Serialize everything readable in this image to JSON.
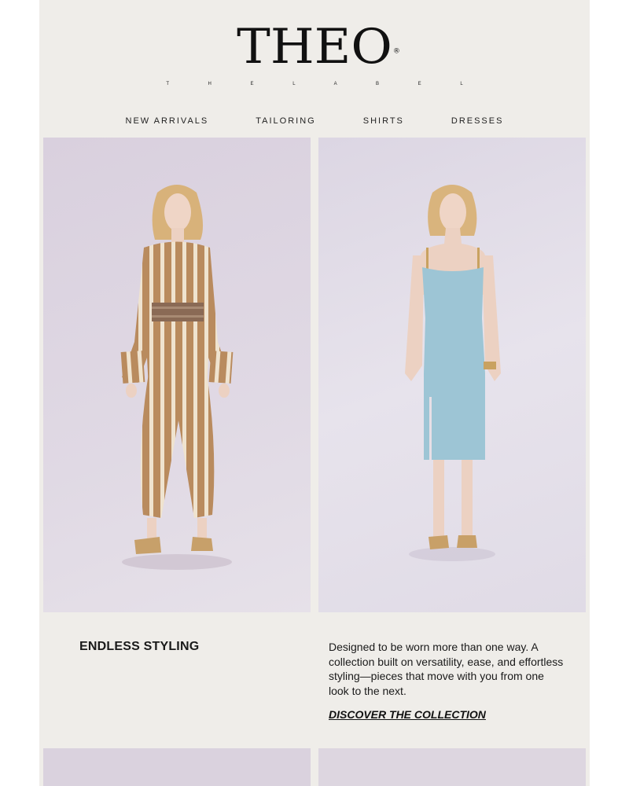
{
  "brand": {
    "logo_text": "THEO",
    "registered_mark": "®",
    "tagline": "T H E   L A B E L"
  },
  "nav": {
    "items": [
      {
        "label": "NEW ARRIVALS"
      },
      {
        "label": "TAILORING"
      },
      {
        "label": "SHIRTS"
      },
      {
        "label": "DRESSES"
      }
    ]
  },
  "hero": {
    "left_image": "model in striped brown and cream shirt with belt and balloon trousers",
    "right_image": "model in light blue midi slip dress"
  },
  "feature": {
    "headline": "ENDLESS STYLING",
    "body": "Designed to be worn more than one way. A collection built on versatility, ease, and effortless styling—pieces that move with you from one look to the next.",
    "cta_label": "DISCOVER THE COLLECTION"
  },
  "colors": {
    "background": "#efede9",
    "text": "#1a1a1a",
    "photo_backdrop": "#dcd3de",
    "stripe_brown": "#b8865a",
    "dress_blue": "#9cc3d4"
  }
}
